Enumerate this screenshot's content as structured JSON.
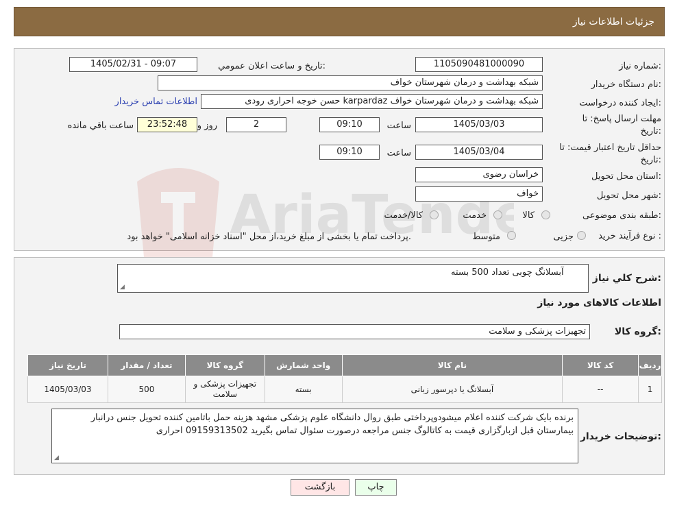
{
  "header": {
    "title": "جزئیات اطلاعات نیاز"
  },
  "watermark": {
    "text": "AriaTender.neT"
  },
  "form": {
    "need_number_label": "شماره نیاز:",
    "need_number": "1105090481000090",
    "announce_label": "تاريخ و ساعت اعلان عمومي:",
    "announce_value": "1405/02/31 - 09:07",
    "buyer_org_label": "نام دستگاه خریدار:",
    "buyer_org": "شبکه بهداشت و درمان شهرستان خواف",
    "creator_label": "ایجاد کننده درخواست:",
    "creator": "حسن خوجه احراری رودی karpardaz شبکه بهداشت و درمان شهرستان خواف",
    "contact_link": "اطلاعات تماس خریدار",
    "deadline_label_1": "مهلت ارسال پاسخ: تا",
    "deadline_label_2": "تاریخ:",
    "deadline_date": "1405/03/03",
    "time_label": "ساعت",
    "deadline_time": "09:10",
    "days_value": "2",
    "days_label": "روز و",
    "remaining_time": "23:52:48",
    "remaining_label": "ساعت باقي مانده",
    "validity_label_1": "حداقل تاریخ اعتبار قیمت: تا",
    "validity_label_2": "تاریخ:",
    "validity_date": "1405/03/04",
    "validity_time": "09:10",
    "province_label": "استان محل تحویل:",
    "province": "خراسان رضوی",
    "city_label": "شهر محل تحویل:",
    "city": "خواف",
    "category_label": "طبقه بندی موضوعی:",
    "category_options": [
      "کالا",
      "خدمت",
      "کالا/خدمت"
    ],
    "process_label": "نوع فرآیند خرید :",
    "process_options": [
      "جزیی",
      "متوسط"
    ],
    "process_note": "پرداخت تمام یا بخشی از مبلغ خرید،از محل \"اسناد خزانه اسلامی\" خواهد بود."
  },
  "details": {
    "summary_label": "شرح کلي نياز:",
    "summary": "آبسلانگ چوبی تعداد 500 بسته",
    "goods_heading": "اطلاعات کالاهای مورد نیاز",
    "group_label": "گروه کالا:",
    "group": "تجهیزات پزشکی و سلامت",
    "table": {
      "headers": [
        "رديف",
        "کد کالا",
        "نام کالا",
        "واحد شمارش",
        "گروه کالا",
        "تعداد / مقدار",
        "تاريخ نياز"
      ],
      "rows": [
        [
          "1",
          "--",
          "آبسلانگ یا دپرسور زبانی",
          "بسته",
          "تجهیزات پزشکی و سلامت",
          "500",
          "1405/03/03"
        ]
      ]
    },
    "buyer_notes_label": "توضیحات خریدار:",
    "buyer_notes": "برنده بایک شرکت کننده اعلام میشودوپرداختی طبق روال دانشگاه علوم پزشکی مشهد هزینه حمل باتامین کننده تحویل جنس درانبار بیمارستان قبل ازبارگزاری قیمت به کاتالوگ جنس مراجعه درصورت سئوال تماس بگیرید 09159313502 احراری"
  },
  "buttons": {
    "print": "چاپ",
    "back": "بازگشت"
  }
}
